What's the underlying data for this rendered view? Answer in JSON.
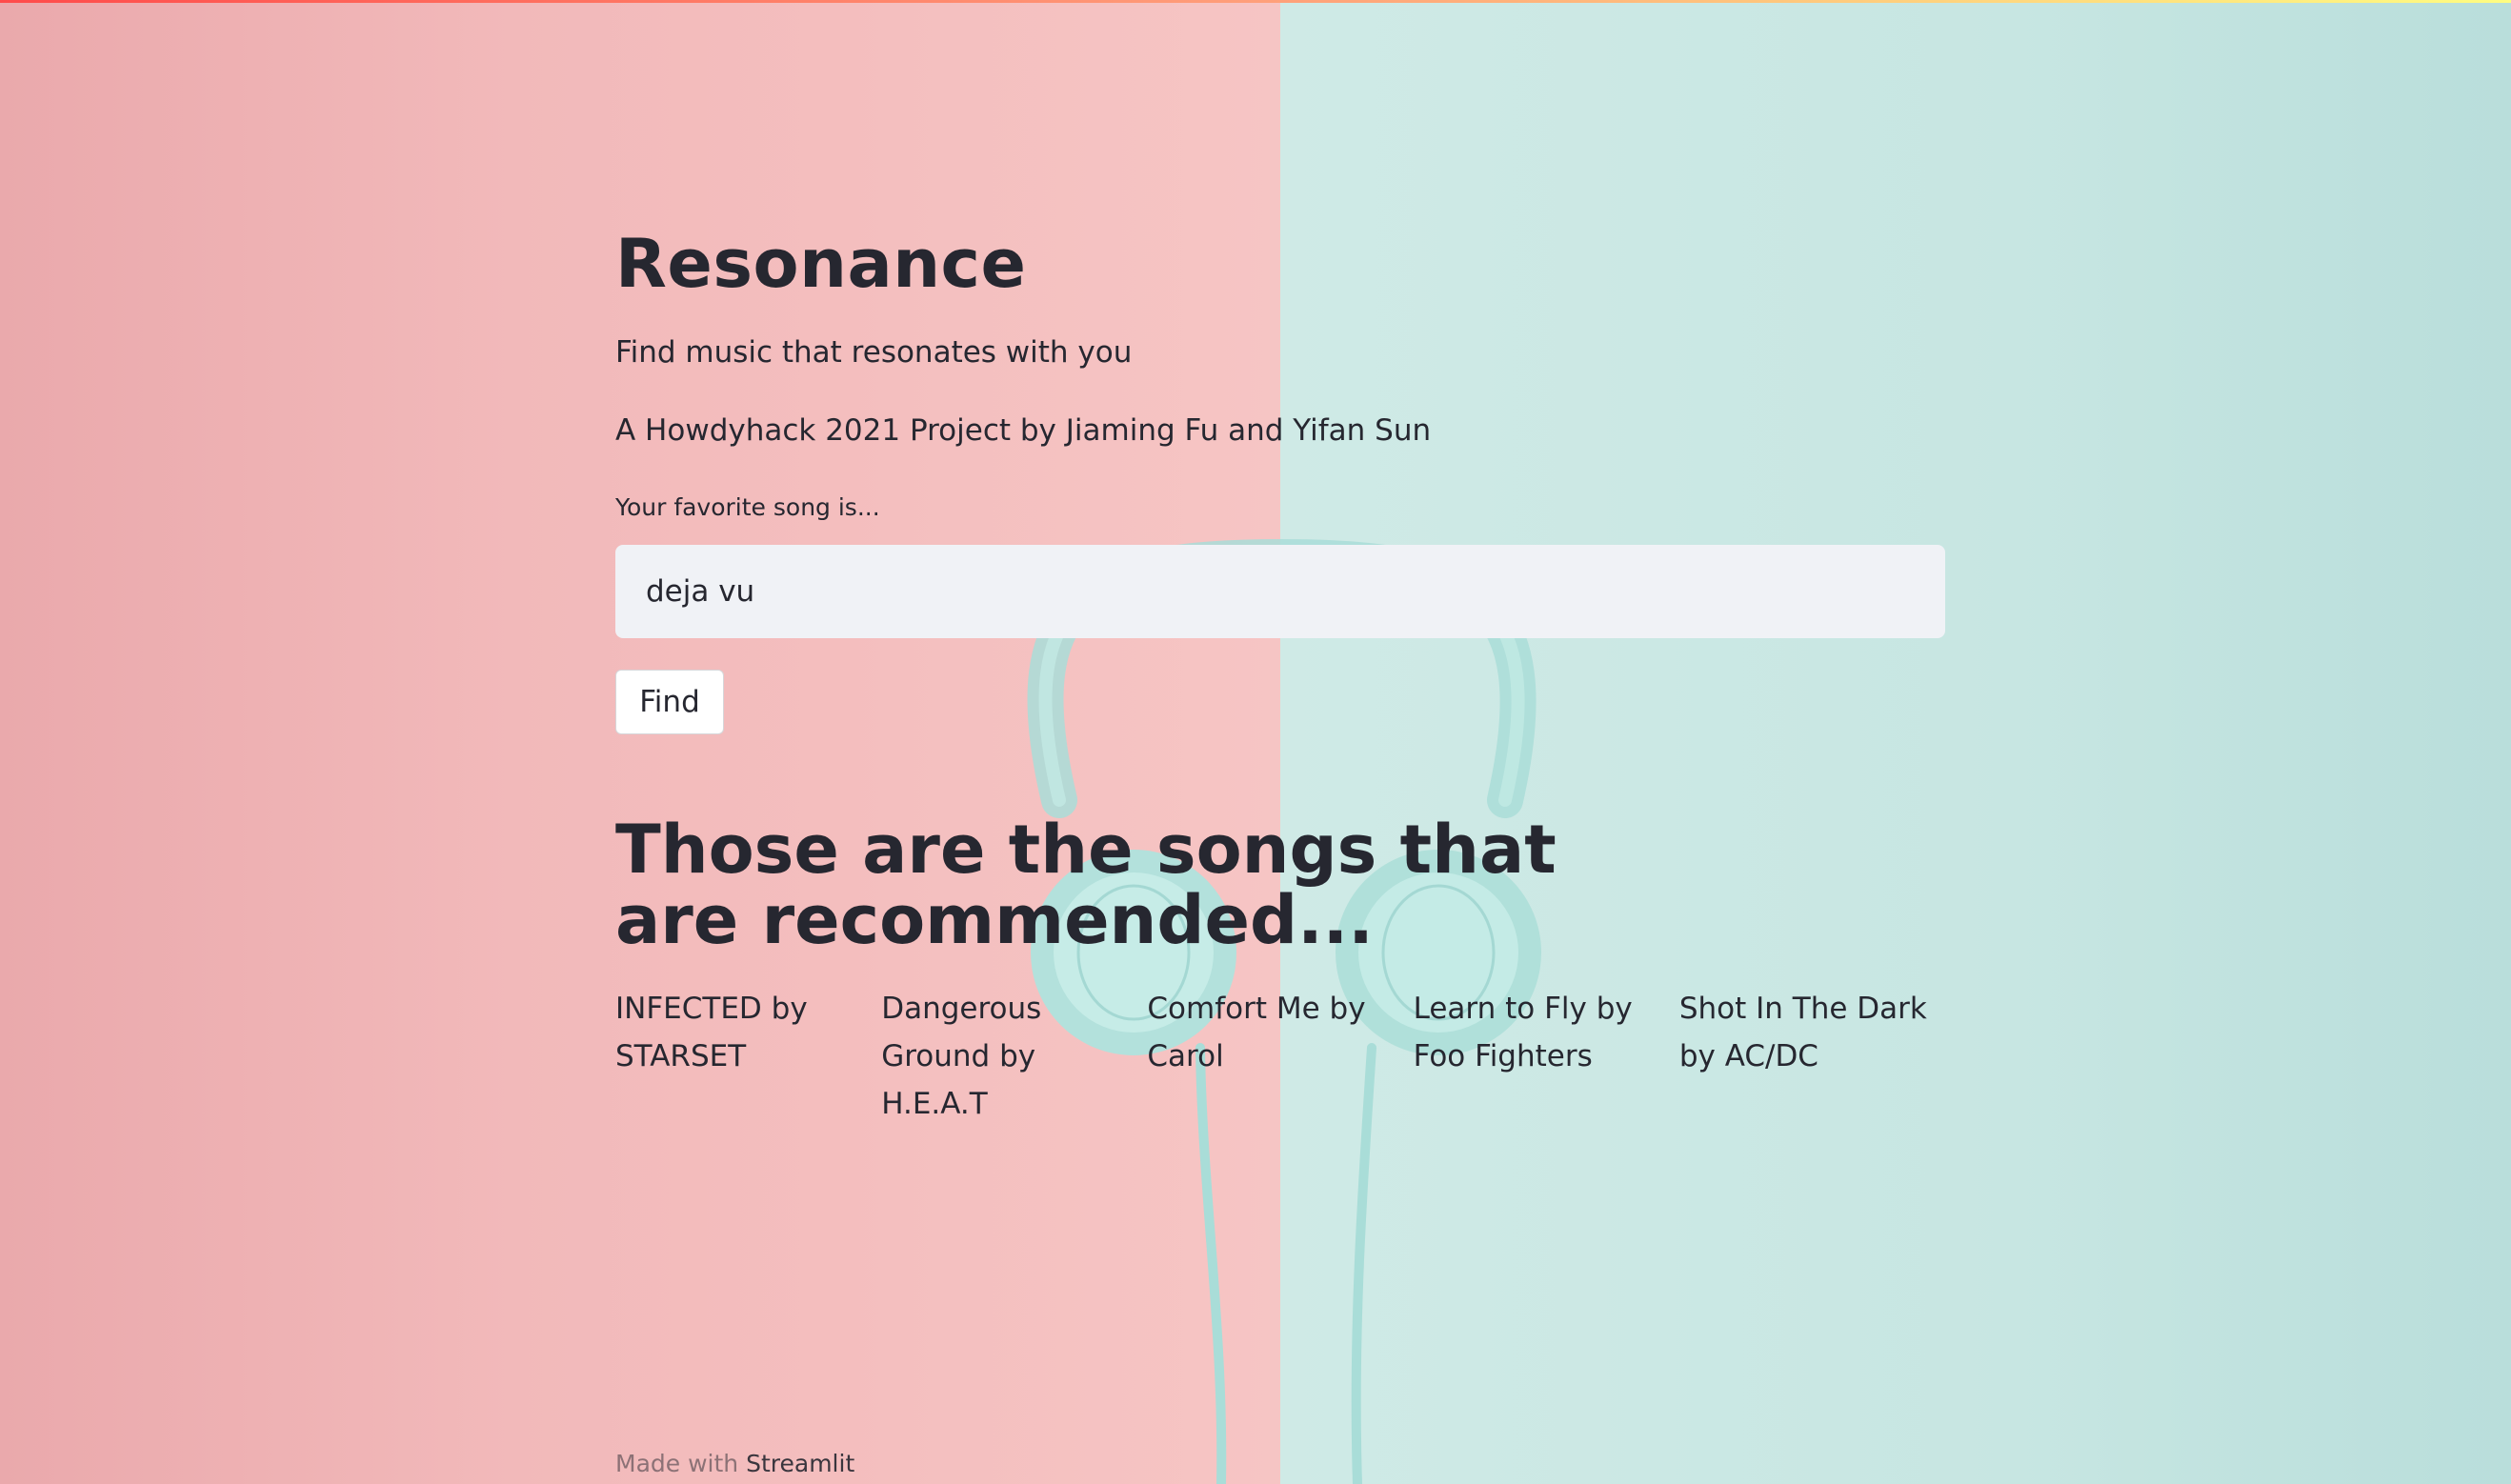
{
  "app": {
    "title": "Resonance",
    "subtitle": "Find music that resonates with you",
    "credit": "A Howdyhack 2021 Project by Jiaming Fu and Yifan Sun"
  },
  "search": {
    "label": "Your favorite song is...",
    "value": "deja vu",
    "button_label": "Find"
  },
  "results": {
    "heading": "Those are the songs that are recommended...",
    "songs": [
      "INFECTED by STARSET",
      "Dangerous Ground by H.E.A.T",
      "Comfort Me by Carol",
      "Learn to Fly by Foo Fighters",
      "Shot In The Dark by AC/DC"
    ]
  },
  "footer": {
    "prefix": "Made with",
    "link": "Streamlit"
  },
  "colors": {
    "background_left": "#f4bfbf",
    "background_right": "#cde9e5",
    "headphones": "#a9ddd8",
    "text": "#262730",
    "input_bg": "#f0f2f6"
  }
}
